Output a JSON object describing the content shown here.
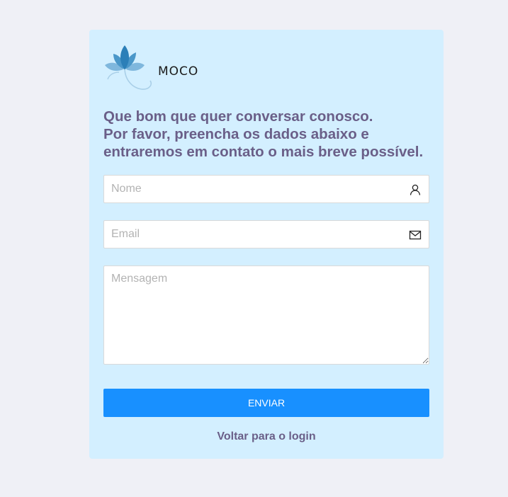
{
  "brand": {
    "logo_text": "MOCO",
    "logo_icon": "lotus-flower-icon",
    "colors": {
      "petal_dark": "#2b7fb8",
      "petal_light": "#7fb7dd",
      "stem": "#a9cfe8"
    }
  },
  "form": {
    "heading_line1": "Que bom que quer conversar conosco.",
    "heading_line2": "Por favor, preencha os dados abaixo e",
    "heading_line3": "entraremos em contato o mais breve possível.",
    "name_placeholder": "Nome",
    "name_icon": "user-icon",
    "email_placeholder": "Email",
    "email_icon": "mail-icon",
    "message_placeholder": "Mensagem",
    "submit_label": "ENVIAR",
    "back_link": "Voltar para o login"
  },
  "colors": {
    "page_bg": "#eff0f6",
    "card_bg": "#d3efff",
    "heading": "#6a5f88",
    "primary": "#1890ff"
  }
}
